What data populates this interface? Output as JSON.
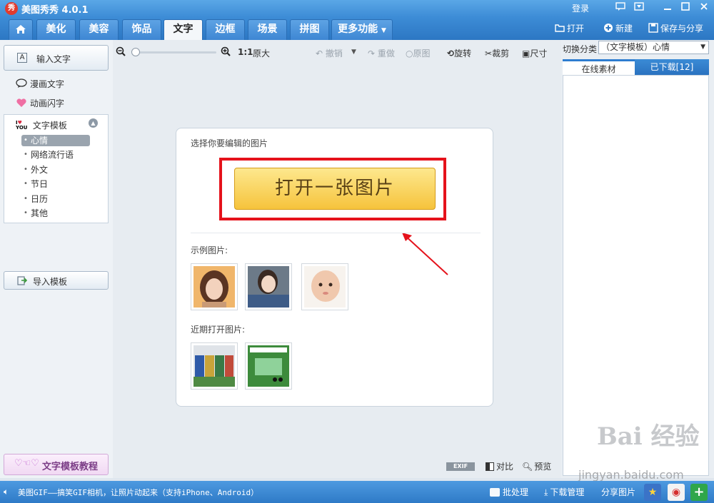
{
  "app": {
    "title": "美图秀秀 4.0.1",
    "logo_text": "秀",
    "login": "登录",
    "window_buttons": [
      "message-icon",
      "menu-icon",
      "minimize-icon",
      "maximize-icon",
      "close-icon"
    ]
  },
  "tabs": [
    {
      "id": "home",
      "label": "",
      "icon": "home-icon"
    },
    {
      "id": "beautify",
      "label": "美化"
    },
    {
      "id": "makeup",
      "label": "美容"
    },
    {
      "id": "accessory",
      "label": "饰品"
    },
    {
      "id": "text",
      "label": "文字",
      "active": true
    },
    {
      "id": "border",
      "label": "边框"
    },
    {
      "id": "scene",
      "label": "场景"
    },
    {
      "id": "collage",
      "label": "拼图"
    },
    {
      "id": "more",
      "label": "更多功能"
    }
  ],
  "toolbar": {
    "open": "打开",
    "new": "新建",
    "save_share": "保存与分享"
  },
  "left": {
    "input_text": "输入文字",
    "comic_text": "漫画文字",
    "animated_text": "动画闪字",
    "template_head": "文字模板",
    "template_items": [
      "心情",
      "网络流行语",
      "外文",
      "节日",
      "日历",
      "其他"
    ],
    "selected_item": "心情",
    "import_template": "导入模板",
    "tutorial": "文字模板教程"
  },
  "canvas_toolbar": {
    "zoom_ratio": "1:1",
    "original_size": "原大",
    "undo": "撤销",
    "redo": "重做",
    "original": "原图",
    "rotate": "旋转",
    "crop": "裁剪",
    "size": "尺寸"
  },
  "open_card": {
    "select_title": "选择你要编辑的图片",
    "open_button": "打开一张图片",
    "example_label": "示例图片:",
    "recent_label": "近期打开图片:",
    "highlight_color": "#e5121b"
  },
  "canvas_footer": {
    "exif": "EXIF",
    "compare": "对比",
    "preview": "预览"
  },
  "right": {
    "category_label": "切换分类",
    "category_value": "（文字模板）心情",
    "tab_online": "在线素材",
    "tab_downloaded": "已下载[12]",
    "watermark": "Bai 经验",
    "watermark_url": "jingyan.baidu.com"
  },
  "status": {
    "text": "美图GIF——搞笑GIF相机，让照片动起来（支持iPhone、Android）",
    "batch": "批处理",
    "download_manager": "下载管理",
    "share_image": "分享图片"
  },
  "colors": {
    "accent": "#2e7dd0",
    "button_yellow": "#f6c33c"
  }
}
